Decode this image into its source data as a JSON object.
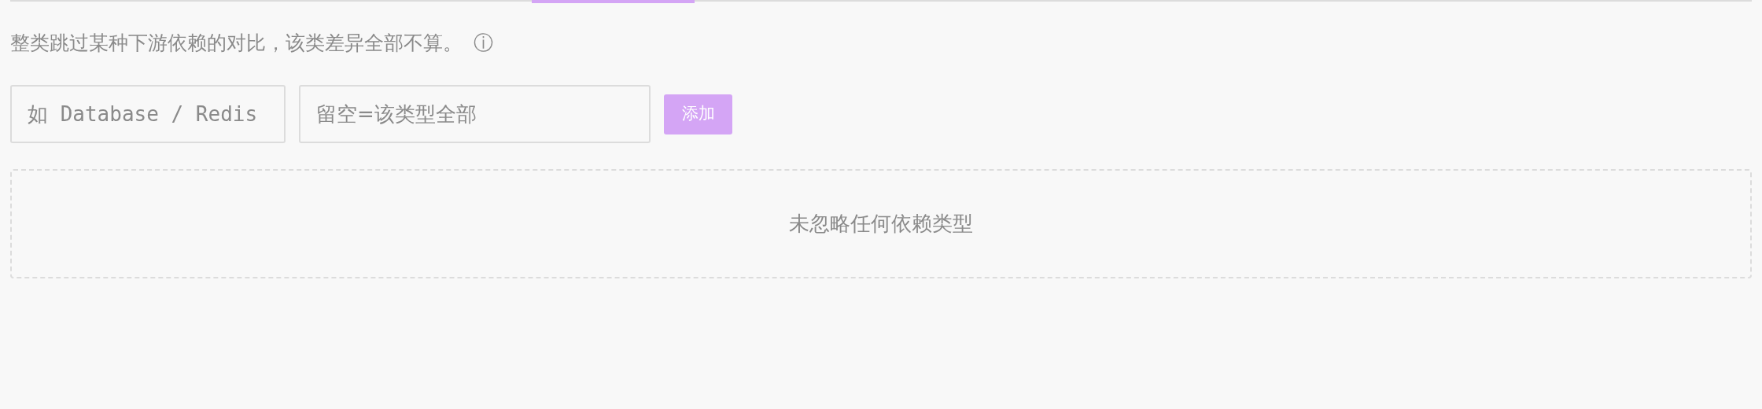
{
  "description": "整类跳过某种下游依赖的对比，该类差异全部不算。",
  "info_icon": "ⓘ",
  "type_field": {
    "placeholder": "如 Database / Redis"
  },
  "name_field": {
    "placeholder": "留空=该类型全部"
  },
  "add_button": "添加",
  "empty_state": "未忽略任何依赖类型"
}
